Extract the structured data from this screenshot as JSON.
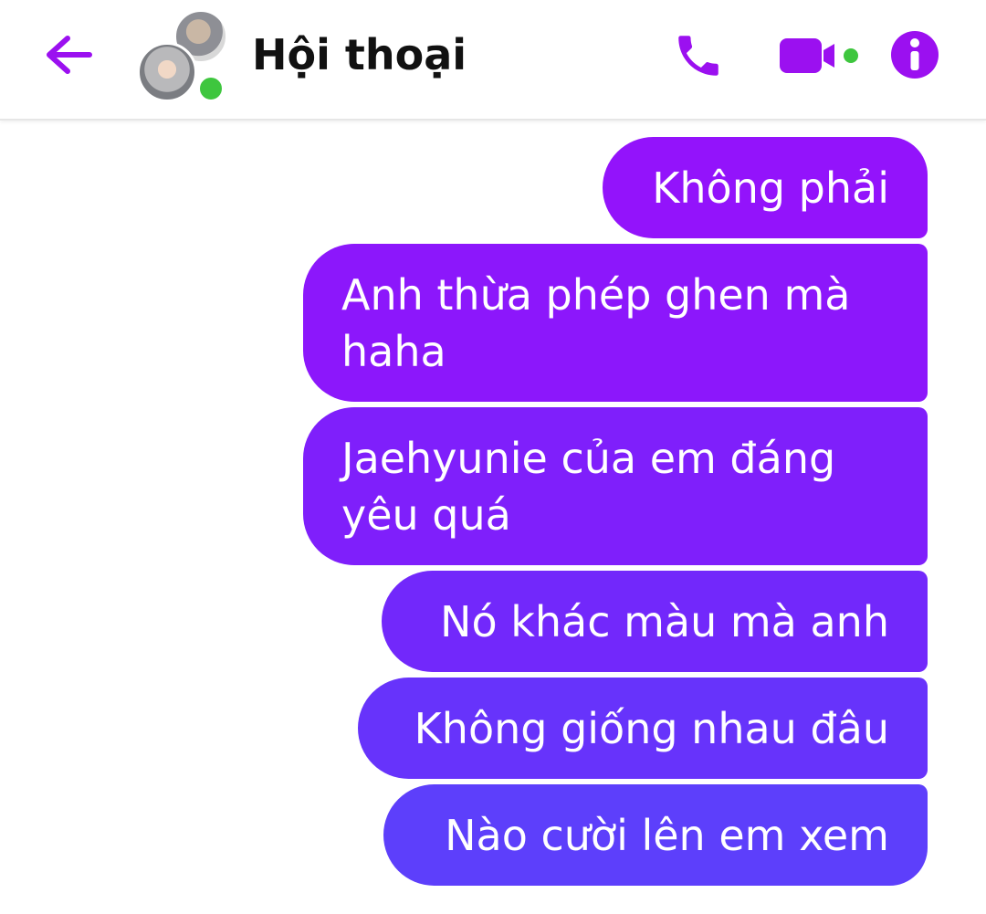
{
  "header": {
    "title": "Hội thoại",
    "back_icon": "back-arrow-icon",
    "call_icon": "phone-icon",
    "video_icon": "video-camera-icon",
    "info_icon": "info-icon",
    "accent_color": "#9b10f0",
    "online_color": "#3ec63e"
  },
  "messages": [
    {
      "text": "Không phải",
      "color": "#9313fb"
    },
    {
      "text": "Anh thừa phép ghen mà haha",
      "color": "#8c17fb"
    },
    {
      "text": "Jaehyunie của em đáng yêu quá",
      "color": "#7f1ffb"
    },
    {
      "text": "Nó khác màu mà anh",
      "color": "#7228fb"
    },
    {
      "text": "Không giống nhau đâu",
      "color": "#6733fb"
    },
    {
      "text": "Nào cười lên em xem",
      "color": "#5d3ffb"
    }
  ]
}
